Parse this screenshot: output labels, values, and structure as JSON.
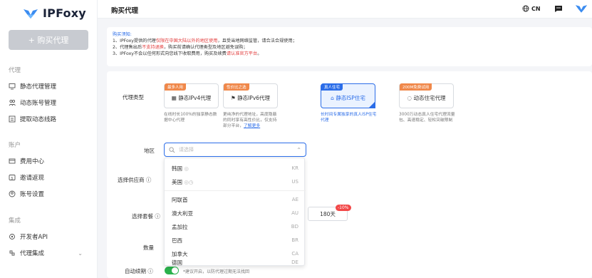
{
  "brand": {
    "name": "IPFoxy",
    "logo_colors": [
      "#3b8cf0",
      "#6fb8ff"
    ]
  },
  "sidebar": {
    "buy_button": "+ 购买代理",
    "sections": [
      {
        "title": "代理",
        "items": [
          {
            "label": "静态代理管理",
            "icon": "monitor-icon"
          },
          {
            "label": "动态账号管理",
            "icon": "users-icon"
          },
          {
            "label": "提取动态线路",
            "icon": "list-icon"
          }
        ]
      },
      {
        "title": "账户",
        "items": [
          {
            "label": "费用中心",
            "icon": "card-icon"
          },
          {
            "label": "邀请返现",
            "icon": "gift-icon"
          },
          {
            "label": "账号设置",
            "icon": "user-icon"
          }
        ]
      },
      {
        "title": "集成",
        "items": [
          {
            "label": "开发者API",
            "icon": "api-icon"
          },
          {
            "label": "代理集成",
            "icon": "puzzle-icon"
          }
        ]
      }
    ]
  },
  "header": {
    "title": "购买代理",
    "language": "CN"
  },
  "notice": {
    "title": "购买须知:",
    "line1_a": "1、IPFoxy提供的代理",
    "line1_red": "仅限在中国大陆以外的地区使用",
    "line1_b": "，且受当地网络监管，请合法合规使用；",
    "line2_a": "2、代理售出后",
    "line2_red": "不支持退换",
    "line2_b": "，购买前请确认代理类型及地区避免误购；",
    "line3_a": "3、IPFoxy不会以任何形式向您线下收取费用，购买及续费",
    "line3_red": "请认准官方平台",
    "line3_b": "。"
  },
  "form": {
    "proxy_type_label": "代理类型",
    "region_label": "地区",
    "supplier_label": "选择供应商",
    "plan_label": "选择套餐",
    "quantity_label": "数量",
    "auto_renew_label": "自动续期",
    "auto_renew_note": "*建议开启，以防代理过期无法找回",
    "region_placeholder": "请选择",
    "duration_option": "180天",
    "duration_discount": "-10%"
  },
  "proxy_types": [
    {
      "badge": "最多人用",
      "name": "静态IPv4代理",
      "desc": "在线时长100%的独享静态数据中心代理",
      "selected": false
    },
    {
      "badge": "性价比之选",
      "name": "静态IPv6代理",
      "desc": "更纯净的代理地址，高度隐蔽的同时享有高性价比，仅支持部分平台，",
      "link": "了解更多",
      "selected": false
    },
    {
      "badge": "真人住宅",
      "name": "静态ISP住宅",
      "desc": "长时间专属独享的真人ISP住宅代理",
      "selected": true
    },
    {
      "badge": "200M免费试用",
      "name": "动态住宅代理",
      "desc": "3000万动态真人住宅代理流量包、高速稳定、轻松突破限制",
      "selected": false
    }
  ],
  "region_options": [
    {
      "name": "韩国",
      "code": "KR"
    },
    {
      "name": "美国",
      "code": "US"
    },
    {
      "name": "阿联酋",
      "code": "AE"
    },
    {
      "name": "澳大利亚",
      "code": "AU"
    },
    {
      "name": "孟加拉",
      "code": "BD"
    },
    {
      "name": "巴西",
      "code": "BR"
    },
    {
      "name": "加拿大",
      "code": "CA"
    },
    {
      "name": "德国",
      "code": "DE"
    }
  ],
  "colors": {
    "accent": "#2b6de8",
    "danger": "#e23b3b",
    "badge_orange": "#f0884a",
    "toggle_on": "#2bb24c"
  }
}
